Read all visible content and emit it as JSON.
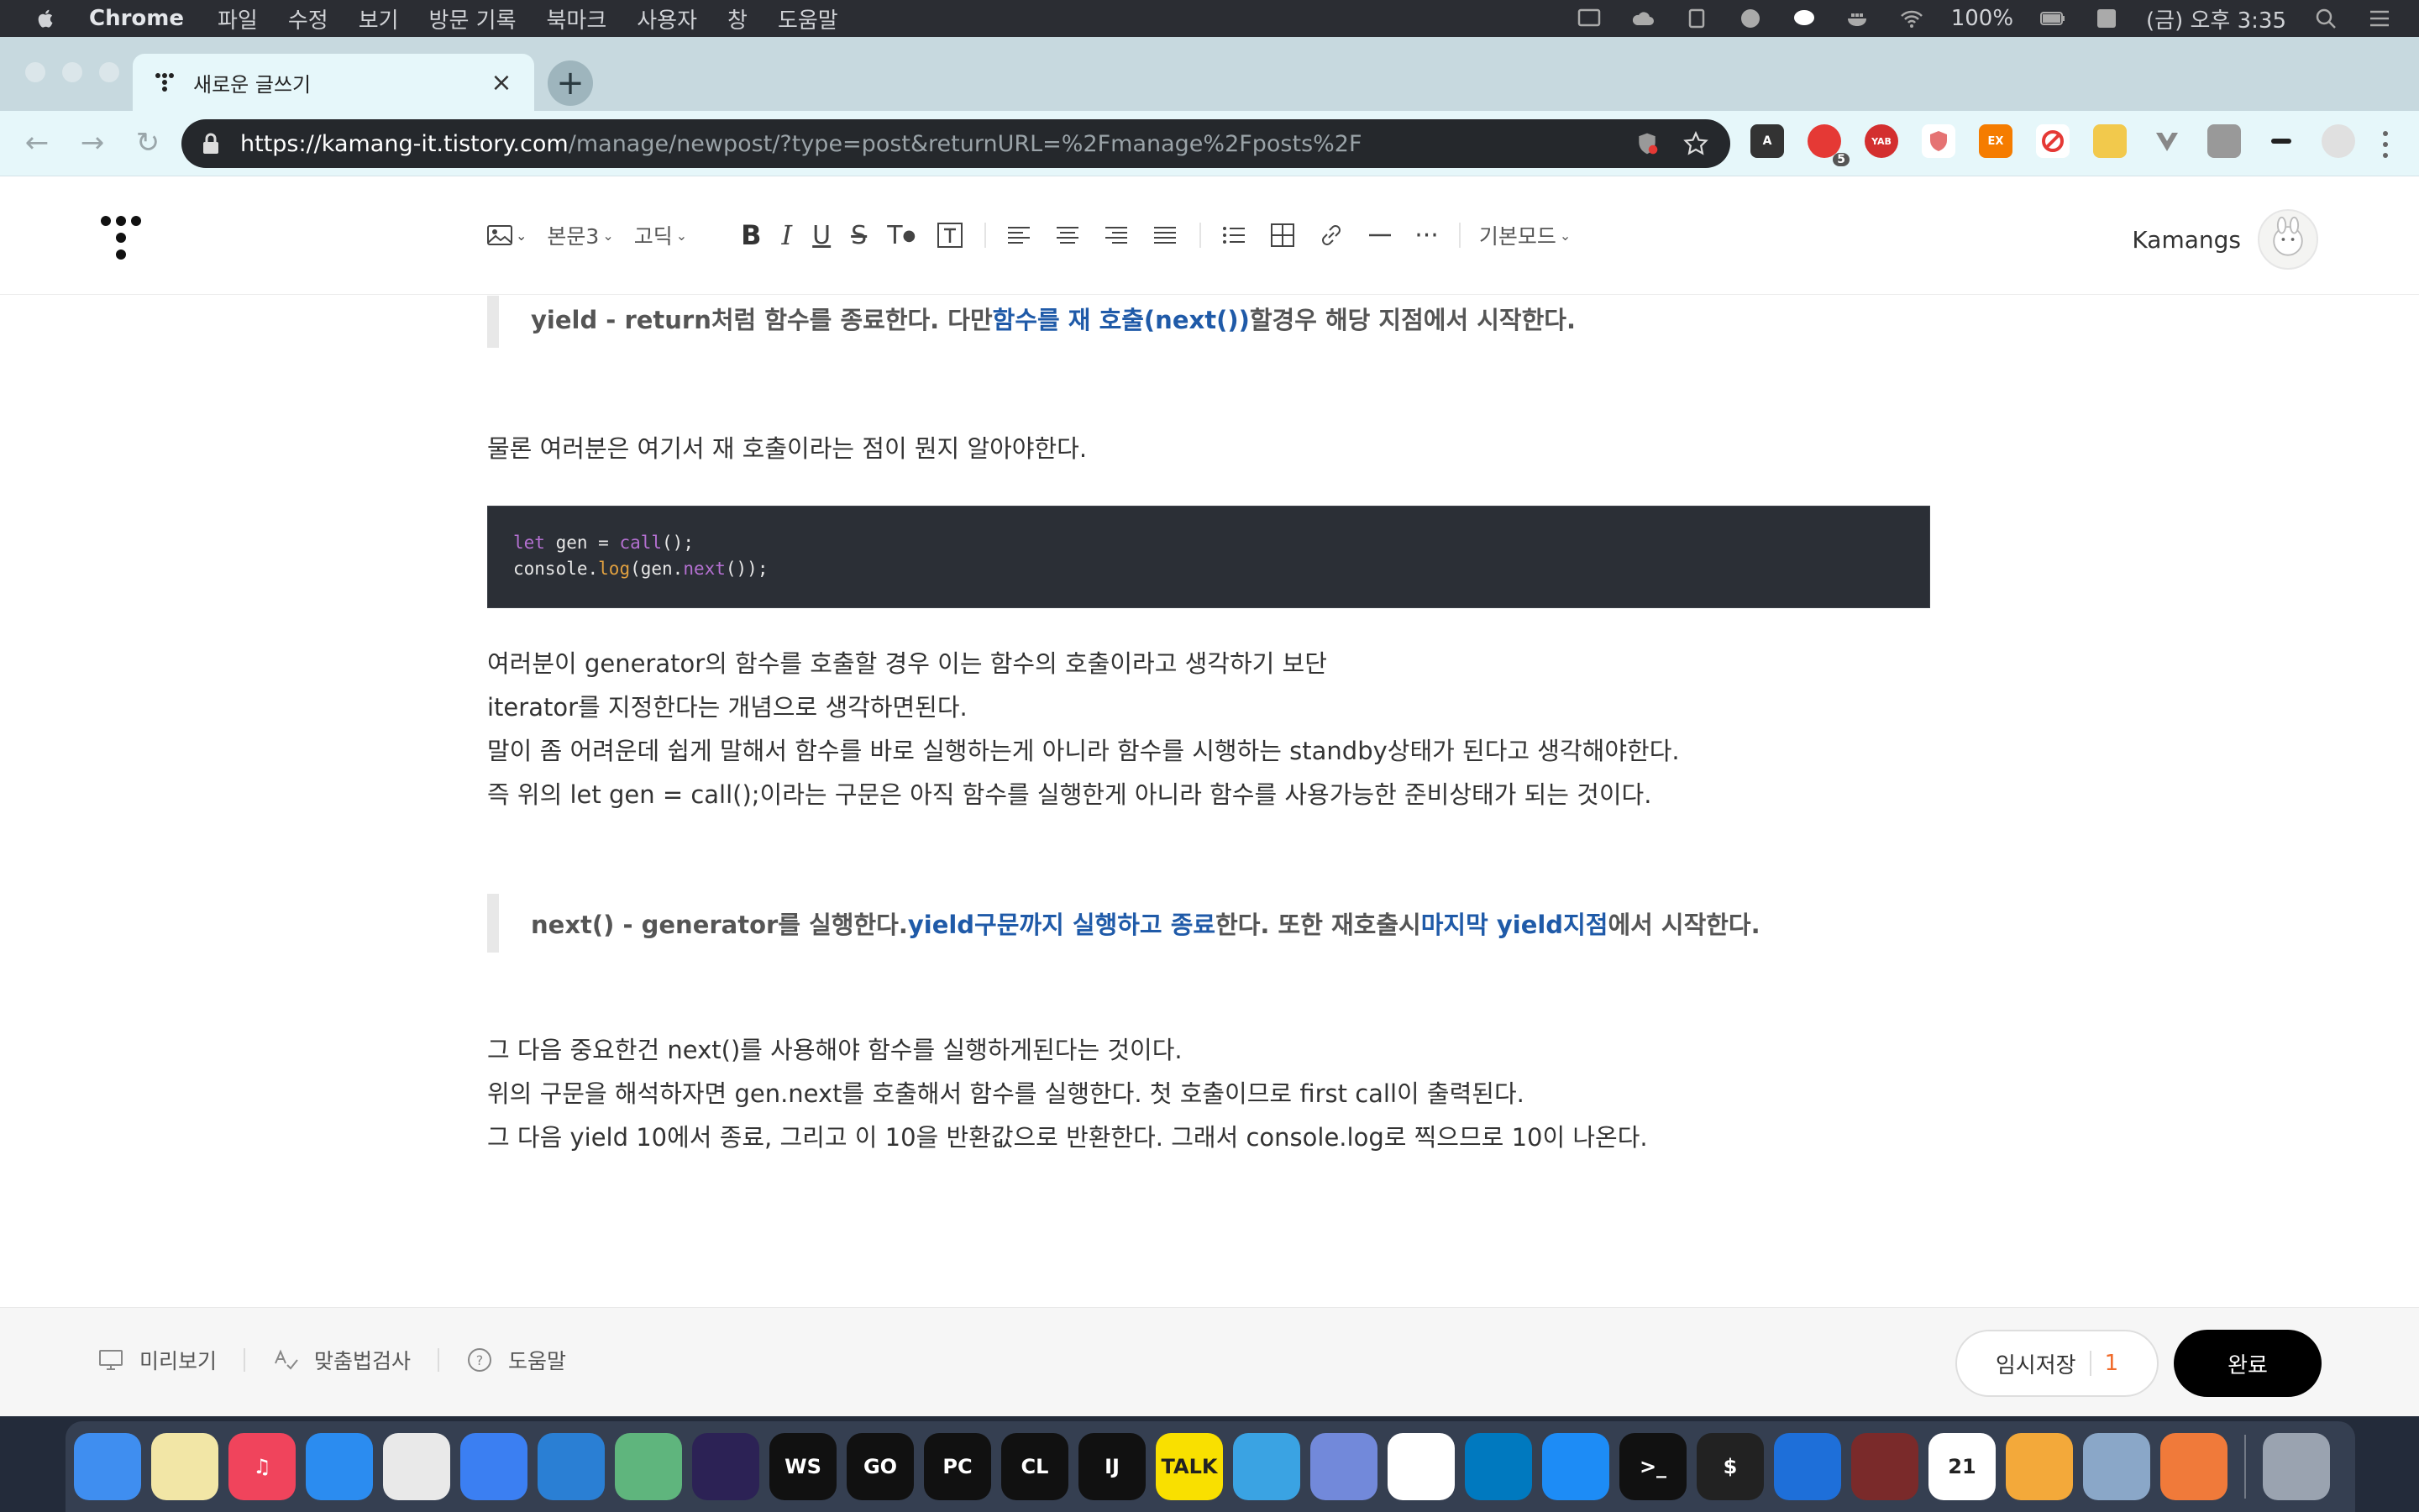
{
  "menubar": {
    "app_name": "Chrome",
    "items": [
      "파일",
      "수정",
      "보기",
      "방문 기록",
      "북마크",
      "사용자",
      "창",
      "도움말"
    ],
    "battery": "100%",
    "clock": "(금) 오후 3:35"
  },
  "browser": {
    "tab_title": "새로운 글쓰기",
    "url_host": "https://kamang-it.tistory.com",
    "url_path": "/manage/newpost/?type=post&returnURL=%2Fmanage%2Fposts%2F",
    "extension_badge": "5",
    "extensions": [
      "A",
      "YAB",
      "EX"
    ]
  },
  "editor": {
    "image_tool": "image-icon",
    "style_select": "본문3",
    "font_select": "고딕",
    "mode_select": "기본모드",
    "user_name": "Kamangs"
  },
  "content": {
    "quote1": {
      "pre": "yield - return처럼 함수를 종료한다. 다만 ",
      "hl": "함수를 재 호출(next())",
      "post": "할경우 해당 지점에서 시작한다."
    },
    "para1": "물론 여러분은 여기서 재 호출이라는 점이 뭔지 알아야한다.",
    "code": {
      "line1_kw": "let",
      "line1_a": " gen = ",
      "line1_fn": "call",
      "line1_b": "();",
      "line2_a": "console.",
      "line2_m": "log",
      "line2_b": "(gen.",
      "line2_fn": "next",
      "line2_c": "());"
    },
    "para2": [
      "여러분이 generator의 함수를 호출할 경우 이는 함수의 호출이라고 생각하기 보단",
      "iterator를 지정한다는 개념으로 생각하면된다.",
      "말이 좀 어려운데 쉽게 말해서 함수를 바로 실행하는게 아니라 함수를 시행하는 standby상태가 된다고 생각해야한다.",
      "즉 위의 let gen = call();이라는 구문은 아직 함수를 실행한게 아니라 함수를 사용가능한 준비상태가 되는 것이다."
    ],
    "quote2": {
      "a": "next() - generator를 실행한다. ",
      "hl1": "yield구문까지 실행하고 종료",
      "b": "한다. 또한 재호출시 ",
      "hl2": "마지막 yield지점",
      "c": "에서 시작한다."
    },
    "para3": [
      "그 다음 중요한건 next()를 사용해야 함수를 실행하게된다는 것이다.",
      "위의 구문을 해석하자면 gen.next를 호출해서 함수를 실행한다. 첫 호출이므로 first call이 출력된다.",
      "그 다음 yield 10에서 종료, 그리고 이 10을 반환값으로 반환한다. 그래서 console.log로 찍으므로 10이 나온다."
    ]
  },
  "bottombar": {
    "preview": "미리보기",
    "spellcheck": "맞춤법검사",
    "help": "도움말",
    "temp_save": "임시저장",
    "temp_count": "1",
    "done": "완료"
  },
  "dock": {
    "apps": [
      {
        "name": "finder",
        "label": "",
        "color": "#3f8ef0"
      },
      {
        "name": "notes",
        "label": "",
        "color": "#f2e6a6"
      },
      {
        "name": "music",
        "label": "♫",
        "color": "#f0445c"
      },
      {
        "name": "safari",
        "label": "",
        "color": "#2b8cf0"
      },
      {
        "name": "chrome",
        "label": "",
        "color": "#e9e9e9"
      },
      {
        "name": "xcode",
        "label": "",
        "color": "#3b7ff2"
      },
      {
        "name": "vscode",
        "label": "",
        "color": "#2a7fd4"
      },
      {
        "name": "atom",
        "label": "",
        "color": "#5fb57d"
      },
      {
        "name": "eclipse",
        "label": "",
        "color": "#2c2255"
      },
      {
        "name": "webstorm",
        "label": "WS",
        "color": "#111"
      },
      {
        "name": "goland",
        "label": "GO",
        "color": "#111"
      },
      {
        "name": "pycharm",
        "label": "PC",
        "color": "#111"
      },
      {
        "name": "clion",
        "label": "CL",
        "color": "#111"
      },
      {
        "name": "intellij",
        "label": "IJ",
        "color": "#111"
      },
      {
        "name": "kakaotalk",
        "label": "TALK",
        "color": "#f9e000"
      },
      {
        "name": "telegram",
        "label": "",
        "color": "#3aa3e3"
      },
      {
        "name": "discord",
        "label": "",
        "color": "#7289da"
      },
      {
        "name": "slack",
        "label": "",
        "color": "#ffffff"
      },
      {
        "name": "trello",
        "label": "",
        "color": "#0079bf"
      },
      {
        "name": "app-store",
        "label": "",
        "color": "#1d8cf6"
      },
      {
        "name": "terminal",
        "label": ">_",
        "color": "#111"
      },
      {
        "name": "iterm",
        "label": "$",
        "color": "#222"
      },
      {
        "name": "maps-pin",
        "label": "",
        "color": "#1e6fd9"
      },
      {
        "name": "photo-booth",
        "label": "",
        "color": "#7a2a2a"
      },
      {
        "name": "calendar",
        "label": "21",
        "color": "#ffffff"
      },
      {
        "name": "tableplus",
        "label": "",
        "color": "#f3a93a"
      },
      {
        "name": "preview",
        "label": "",
        "color": "#8aa7c8"
      },
      {
        "name": "swift-playgrounds",
        "label": "",
        "color": "#f07a3a"
      },
      {
        "name": "trash",
        "label": "",
        "color": "#9aa3b0"
      }
    ]
  }
}
